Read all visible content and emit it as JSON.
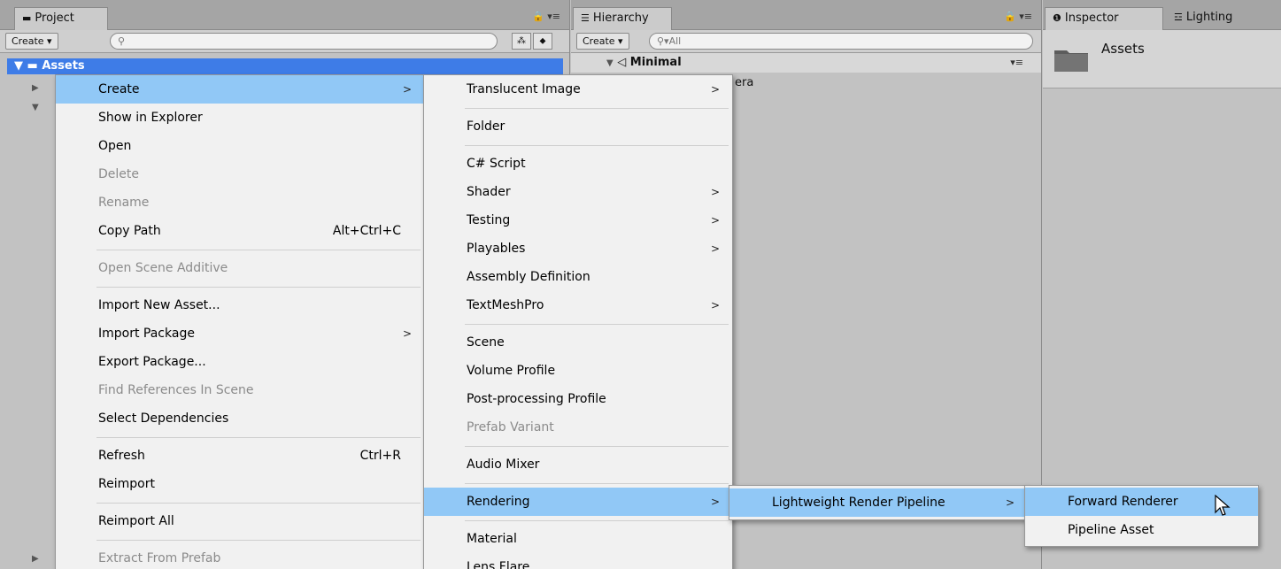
{
  "project": {
    "tab_label": "Project",
    "create_label": "Create",
    "search_placeholder": "",
    "root_label": "Assets"
  },
  "hierarchy": {
    "tab_label": "Hierarchy",
    "create_label": "Create",
    "search_placeholder": "All",
    "scene_name": "Minimal",
    "camera_suffix": "era"
  },
  "inspector": {
    "tab_label": "Inspector",
    "lighting_tab_label": "Lighting",
    "title": "Assets"
  },
  "context_menu": {
    "items": [
      {
        "label": "Create",
        "submenu": true,
        "highlighted": true
      },
      {
        "label": "Show in Explorer"
      },
      {
        "label": "Open"
      },
      {
        "label": "Delete",
        "disabled": true
      },
      {
        "label": "Rename",
        "disabled": true
      },
      {
        "label": "Copy Path",
        "shortcut": "Alt+Ctrl+C"
      },
      {
        "label": "Open Scene Additive",
        "disabled": true
      },
      {
        "label": "Import New Asset..."
      },
      {
        "label": "Import Package",
        "submenu": true
      },
      {
        "label": "Export Package..."
      },
      {
        "label": "Find References In Scene",
        "disabled": true
      },
      {
        "label": "Select Dependencies"
      },
      {
        "label": "Refresh",
        "shortcut": "Ctrl+R"
      },
      {
        "label": "Reimport"
      },
      {
        "label": "Reimport All"
      },
      {
        "label": "Extract From Prefab",
        "disabled": true
      }
    ]
  },
  "create_menu": {
    "items": [
      {
        "label": "Translucent Image",
        "submenu": true
      },
      {
        "label": "Folder"
      },
      {
        "label": "C# Script"
      },
      {
        "label": "Shader",
        "submenu": true
      },
      {
        "label": "Testing",
        "submenu": true
      },
      {
        "label": "Playables",
        "submenu": true
      },
      {
        "label": "Assembly Definition"
      },
      {
        "label": "TextMeshPro",
        "submenu": true
      },
      {
        "label": "Scene"
      },
      {
        "label": "Volume Profile"
      },
      {
        "label": "Post-processing Profile"
      },
      {
        "label": "Prefab Variant",
        "disabled": true
      },
      {
        "label": "Audio Mixer"
      },
      {
        "label": "Rendering",
        "submenu": true,
        "highlighted": true
      },
      {
        "label": "Material"
      },
      {
        "label": "Lens Flare"
      }
    ]
  },
  "rendering_menu": {
    "items": [
      {
        "label": "Lightweight Render Pipeline",
        "submenu": true,
        "highlighted": true
      }
    ]
  },
  "lwrp_menu": {
    "items": [
      {
        "label": "Forward Renderer",
        "highlighted": true
      },
      {
        "label": "Pipeline Asset"
      }
    ]
  },
  "colors": {
    "highlight": "#91c8f6",
    "selection": "#3e7ce7",
    "menu_bg": "#f1f1f1",
    "panel_bg": "#c2c2c2",
    "disabled_text": "#8b8b8b"
  }
}
